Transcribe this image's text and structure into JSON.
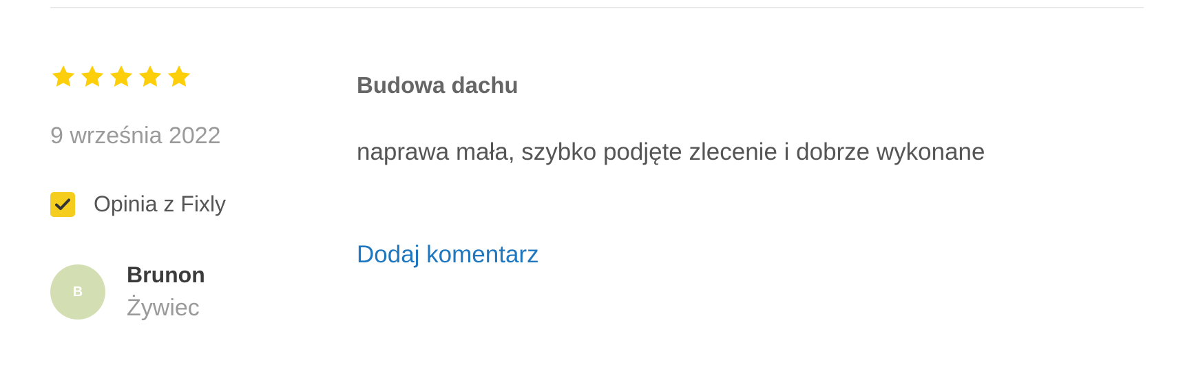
{
  "review": {
    "rating": 5,
    "rating_max": 5,
    "star_color": "#fccf0a",
    "date": "9 września 2022",
    "source_label": "Opinia z Fixly",
    "source_icon": "checkmark-icon",
    "source_accent": "#f5cd1f",
    "author": {
      "initial": "B",
      "name": "Brunon",
      "city": "Żywiec",
      "avatar_color": "#d3deb3"
    },
    "job_title": "Budowa dachu",
    "text": "naprawa mała, szybko podjęte zlecenie i dobrze wykonane",
    "add_comment_label": "Dodaj komentarz",
    "link_color": "#1f78bf"
  }
}
